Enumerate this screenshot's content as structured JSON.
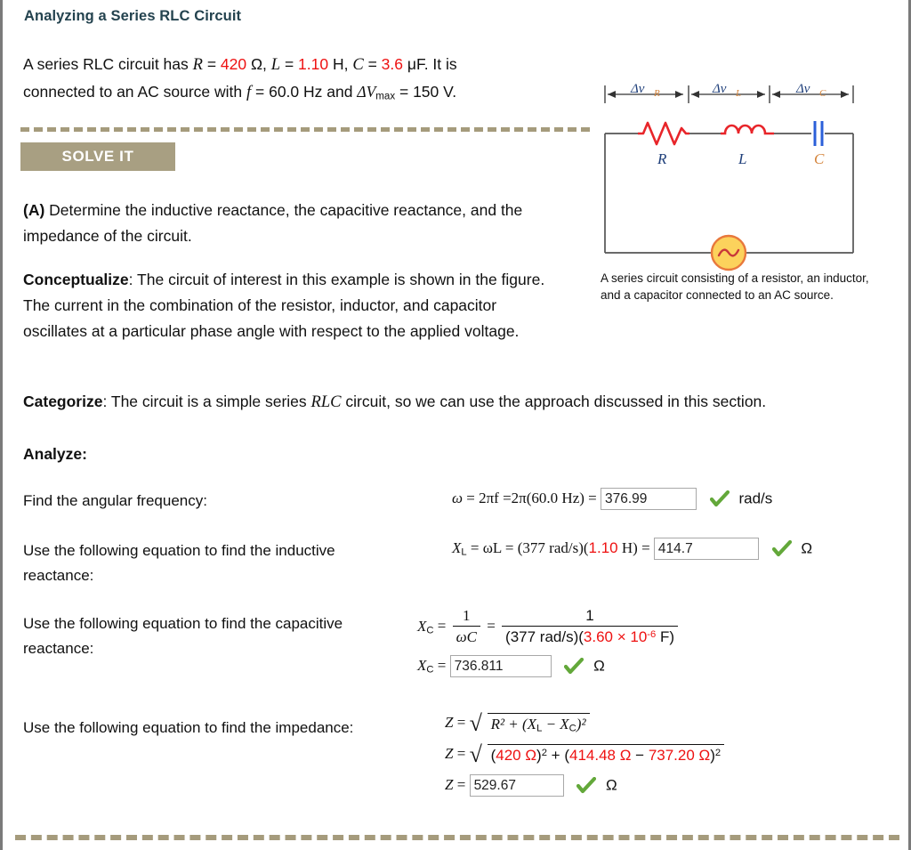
{
  "title": "Analyzing a Series RLC Circuit",
  "problem": {
    "t1": "A series RLC circuit has ",
    "r_sym": "R",
    "eq1": " = ",
    "r_val": "420",
    "r_unit": " Ω, ",
    "l_sym": "L",
    "l_val": "1.10",
    "l_unit": " H, ",
    "c_sym": "C",
    "c_val": "3.6",
    "c_unit": " μF. It is",
    "t2": "connected to an AC source with ",
    "f_sym": "f",
    "f_val": " = 60.0 Hz and ",
    "dv_sym": "ΔV",
    "dv_sub": "max",
    "dv_val": " = 150 V."
  },
  "solve_it_label": "SOLVE IT",
  "part_a": {
    "marker": "(A)",
    "text": " Determine the inductive reactance, the capacitive reactance, and the impedance of the circuit."
  },
  "conceptualize": {
    "lead": "Conceptualize",
    "text": ": The circuit of interest in this example is shown in the figure. The current in the combination of the resistor, inductor, and capacitor oscillates at a particular phase angle with respect to the applied voltage."
  },
  "categorize": {
    "lead": "Categorize",
    "t1": ": The circuit is a simple series ",
    "em": "RLC",
    "t2": " circuit, so we can use the approach discussed in this section."
  },
  "analyze_label": "Analyze:",
  "figure": {
    "label_vr": "Δv",
    "label_vr_sub": "R",
    "label_vl": "Δv",
    "label_vl_sub": "L",
    "label_vc": "Δv",
    "label_vc_sub": "C",
    "comp_r": "R",
    "comp_l": "L",
    "comp_c": "C",
    "source_symbol": "~",
    "caption": "A series circuit consisting of a resistor, an inductor, and a capacitor connected to an AC source.",
    "colors": {
      "component_red": "#e8252a",
      "capacitor_blue": "#2b5fd9",
      "label_blue": "#1f3f7a",
      "label_orange": "#d4833a",
      "source_fill": "#fcd25c",
      "source_stroke": "#e8783c",
      "wire": "#555555"
    }
  },
  "rows": [
    {
      "label": "Find the angular frequency:",
      "eq_lhs": "ω",
      "eq_mid": " = 2πf =2π(60.0 Hz) = ",
      "answer": "376.99",
      "unit": "rad/s",
      "status": "correct"
    },
    {
      "label": "Use the following equation to find the inductive reactance:",
      "eq_lhs": "X",
      "eq_lhs_sub": "L",
      "eq_mid": " = ωL = (377 rad/s)(",
      "highlight": "1.10",
      "eq_tail": " H) = ",
      "answer": "414.7",
      "unit": "Ω",
      "status": "correct"
    },
    {
      "label": "Use the following equation to find the capacitive reactance:",
      "xc_lhs": "X",
      "xc_sub": "C",
      "eq": " = ",
      "frac1_num": "1",
      "frac1_den": "ωC",
      "frac2_num": "1",
      "frac2_den_pre": "(377 rad/s)(",
      "frac2_den_hl": "3.60 × 10",
      "frac2_den_exp": "-6",
      "frac2_den_post": " F)",
      "answer": "736.811",
      "unit": "Ω",
      "status": "correct"
    },
    {
      "label": "Use the following equation to find the impedance:",
      "z_lhs": "Z",
      "eq": " = ",
      "sym_body_1": "R² + (X",
      "sym_sub_l": "L",
      "sym_mid": " − X",
      "sym_sub_c": "C",
      "sym_tail": ")²",
      "num_r": "420 Ω",
      "num_xl": "414.48 Ω",
      "num_xc": "737.20 Ω",
      "answer": "529.67",
      "unit": "Ω",
      "status": "correct"
    }
  ],
  "colors": {
    "title": "#24434f",
    "red_value": "#ee1111",
    "banner_bg": "#a89f82",
    "dash_rule": "#a59b7c",
    "check_green": "#63a83a",
    "input_border": "#a8a8a8"
  }
}
